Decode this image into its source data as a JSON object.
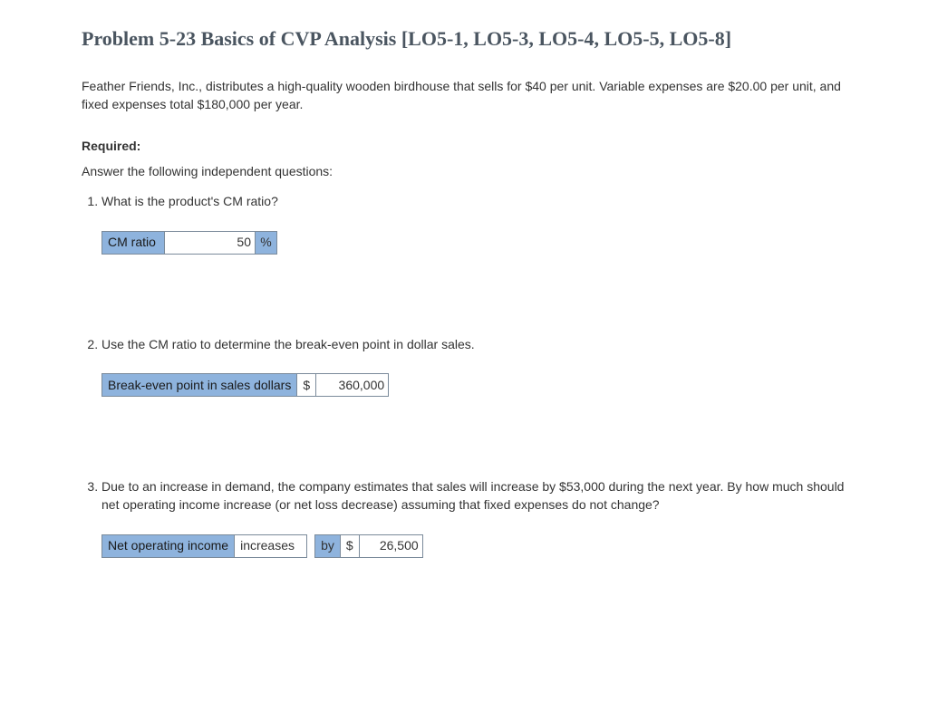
{
  "title": "Problem 5-23 Basics of CVP Analysis [LO5-1, LO5-3, LO5-4, LO5-5, LO5-8]",
  "intro": "Feather Friends, Inc., distributes a high-quality wooden birdhouse that sells for $40 per unit. Variable expenses are $20.00 per unit, and fixed expenses total $180,000 per year.",
  "required_label": "Required:",
  "subhead": "Answer the following independent questions:",
  "q1": {
    "text": "What is the product's CM ratio?",
    "label": "CM ratio",
    "value": "50",
    "unit": "%"
  },
  "q2": {
    "text": "Use the CM ratio to determine the break-even point in dollar sales.",
    "label": "Break-even point in sales dollars",
    "currency": "$",
    "value": "360,000"
  },
  "q3": {
    "text": "Due to an increase in demand, the company estimates that sales will increase by $53,000 during the next year. By how much should net operating income increase (or net loss decrease) assuming that fixed expenses do not change?",
    "label": "Net operating income",
    "direction": "increases",
    "by": "by",
    "currency": "$",
    "value": "26,500"
  }
}
